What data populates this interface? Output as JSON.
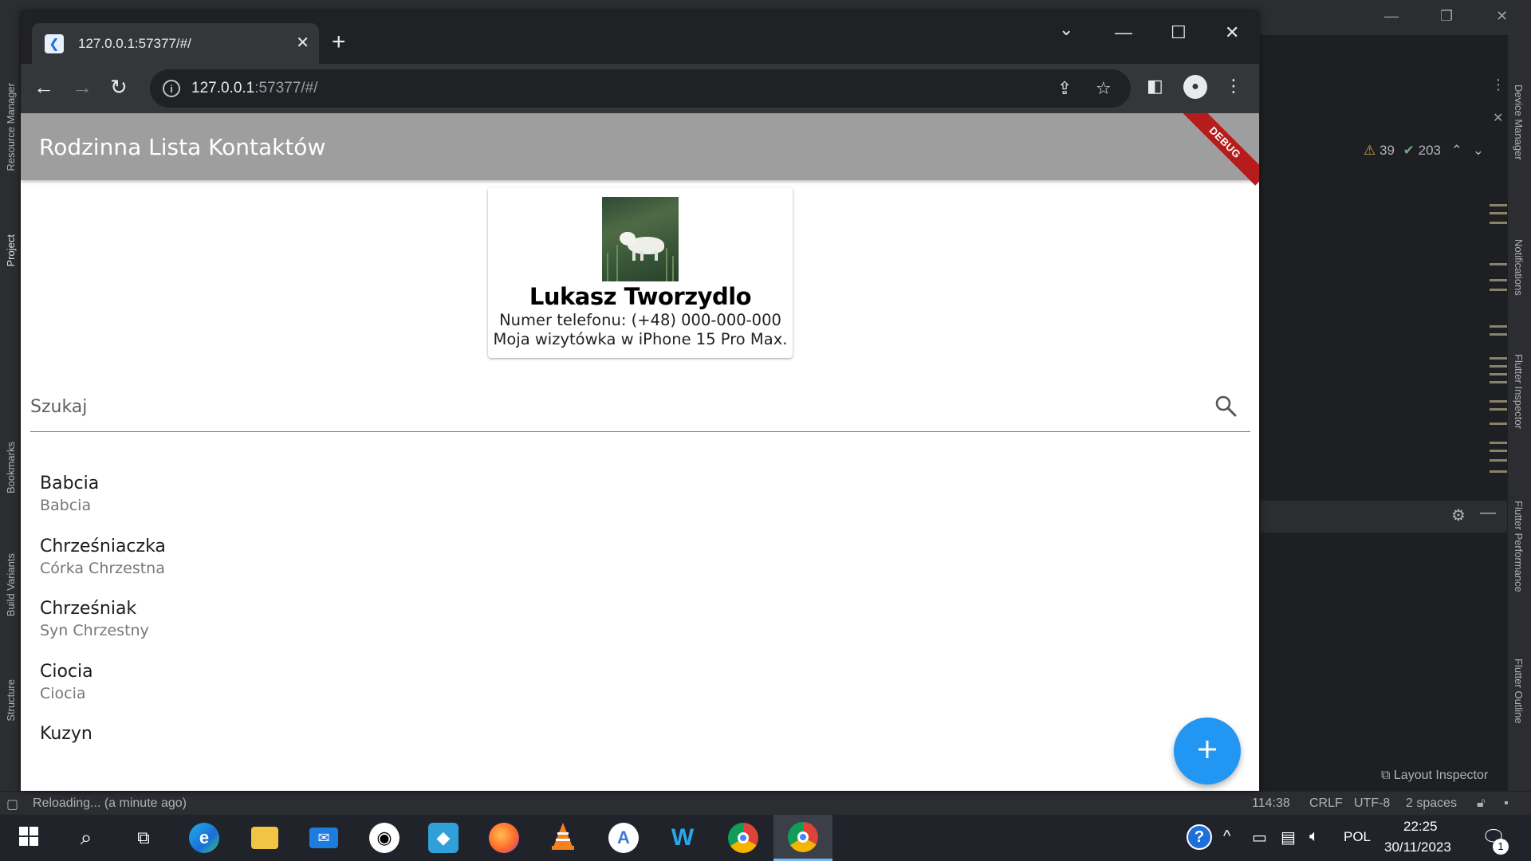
{
  "ide": {
    "left_tabs": [
      "Resource Manager",
      "Project",
      "Bookmarks",
      "Build Variants",
      "Structure"
    ],
    "right_tabs": [
      "Device Manager",
      "Notifications",
      "Flutter Inspector",
      "Flutter Performance",
      "Flutter Outline"
    ],
    "warnings_count": "39",
    "checks_count": "203",
    "layout_inspector_label": "Layout Inspector",
    "status_message": "Reloading... (a minute ago)",
    "status_position": "114:38",
    "status_line_ending": "CRLF",
    "status_encoding": "UTF-8",
    "status_indent": "2 spaces"
  },
  "browser": {
    "tab_title": "127.0.0.1:57377/#/",
    "url_host": "127.0.0.1",
    "url_rest": ":57377/#/"
  },
  "app": {
    "title": "Rodzinna Lista Kontaktów",
    "debug_label": "DEBUG",
    "profile": {
      "name": "Lukasz Tworzydlo",
      "phone_line": "Numer telefonu: (+48) 000-000-000",
      "description": "Moja wizytówka w iPhone 15 Pro Max."
    },
    "search": {
      "placeholder": "Szukaj"
    },
    "contacts": [
      {
        "name": "Babcia",
        "relation": "Babcia"
      },
      {
        "name": "Chrześniaczka",
        "relation": "Córka Chrzestna"
      },
      {
        "name": "Chrześniak",
        "relation": "Syn Chrzestny"
      },
      {
        "name": "Ciocia",
        "relation": "Ciocia"
      },
      {
        "name": "Kuzyn",
        "relation": ""
      }
    ],
    "fab_icon": "plus-icon"
  },
  "taskbar": {
    "language": "POL",
    "time": "22:25",
    "date": "30/11/2023",
    "notification_count": "1"
  },
  "colors": {
    "appbar": "#9e9e9e",
    "fab": "#2196f3",
    "debug_banner": "#b71c1c"
  }
}
